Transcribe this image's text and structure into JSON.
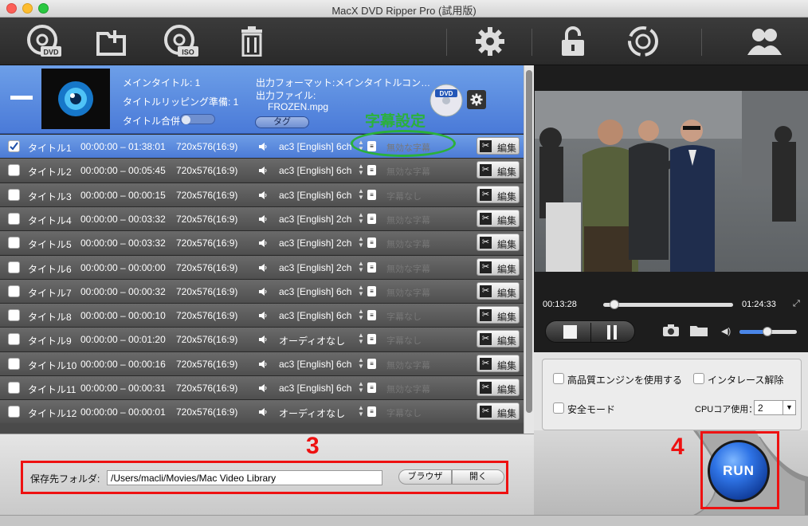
{
  "window": {
    "title": "MacX DVD Ripper Pro (試用版)"
  },
  "toolbar": {
    "icons": [
      "dvd-icon",
      "add-folder-icon",
      "iso-icon",
      "trash-icon",
      "settings-gear-icon",
      "unlock-icon",
      "update-refresh-icon",
      "users-icon"
    ],
    "dvd_label": "DVD",
    "iso_label": "ISO"
  },
  "dvd_info": {
    "main_title": "メインタイトル: 1",
    "ripping_prep": "タイトルリッピング準備: 1",
    "title_merge": "タイトル合併",
    "output_format": "出力フォーマット:メインタイトルコン…",
    "output_file_label": "出力ファイル:",
    "output_file": "FROZEN.mpg",
    "tag_button": "タグ",
    "dvd_badge": "DVD"
  },
  "annotation_subtitle": "字幕設定",
  "titles": [
    {
      "name": "タイトル1",
      "time": "00:00:00 – 01:38:01",
      "res": "720x576(16:9)",
      "audio": "ac3 [English] 6ch",
      "subtitle": "無効な字幕",
      "checked": true,
      "selected": true
    },
    {
      "name": "タイトル2",
      "time": "00:00:00 – 00:05:45",
      "res": "720x576(16:9)",
      "audio": "ac3 [English] 6ch",
      "subtitle": "無効な字幕",
      "checked": false,
      "selected": false
    },
    {
      "name": "タイトル3",
      "time": "00:00:00 – 00:00:15",
      "res": "720x576(16:9)",
      "audio": "ac3 [English] 6ch",
      "subtitle": "字幕なし",
      "checked": false,
      "selected": false
    },
    {
      "name": "タイトル4",
      "time": "00:00:00 – 00:03:32",
      "res": "720x576(16:9)",
      "audio": "ac3 [English] 2ch",
      "subtitle": "無効な字幕",
      "checked": false,
      "selected": false
    },
    {
      "name": "タイトル5",
      "time": "00:00:00 – 00:03:32",
      "res": "720x576(16:9)",
      "audio": "ac3 [English] 2ch",
      "subtitle": "無効な字幕",
      "checked": false,
      "selected": false
    },
    {
      "name": "タイトル6",
      "time": "00:00:00 – 00:00:00",
      "res": "720x576(16:9)",
      "audio": "ac3 [English] 2ch",
      "subtitle": "無効な字幕",
      "checked": false,
      "selected": false
    },
    {
      "name": "タイトル7",
      "time": "00:00:00 – 00:00:32",
      "res": "720x576(16:9)",
      "audio": "ac3 [English] 6ch",
      "subtitle": "無効な字幕",
      "checked": false,
      "selected": false
    },
    {
      "name": "タイトル8",
      "time": "00:00:00 – 00:00:10",
      "res": "720x576(16:9)",
      "audio": "ac3 [English] 6ch",
      "subtitle": "字幕なし",
      "checked": false,
      "selected": false
    },
    {
      "name": "タイトル9",
      "time": "00:00:00 – 00:01:20",
      "res": "720x576(16:9)",
      "audio": "オーディオなし",
      "subtitle": "字幕なし",
      "checked": false,
      "selected": false
    },
    {
      "name": "タイトル10",
      "time": "00:00:00 – 00:00:16",
      "res": "720x576(16:9)",
      "audio": "ac3 [English] 6ch",
      "subtitle": "無効な字幕",
      "checked": false,
      "selected": false
    },
    {
      "name": "タイトル11",
      "time": "00:00:00 – 00:00:31",
      "res": "720x576(16:9)",
      "audio": "ac3 [English] 6ch",
      "subtitle": "無効な字幕",
      "checked": false,
      "selected": false
    },
    {
      "name": "タイトル12",
      "time": "00:00:00 – 00:00:01",
      "res": "720x576(16:9)",
      "audio": "オーディオなし",
      "subtitle": "字幕なし",
      "checked": false,
      "selected": false
    }
  ],
  "edit_label": "編集",
  "output": {
    "folder_label": "保存先フォルダ:",
    "folder_path": "/Users/macli/Movies/Mac Video Library",
    "browse_button": "ブラウザ",
    "open_button": "開く"
  },
  "player": {
    "time_current": "00:13:28",
    "time_total": "01:24:33",
    "progress": 0.05,
    "volume": 0.48
  },
  "options": {
    "high_quality": "高品質エンジンを使用する",
    "deinterlace": "インタレース解除",
    "safe_mode": "安全モード",
    "cpu_label": "CPUコア使用：",
    "cpu_value": "2"
  },
  "run_button": "RUN",
  "step_labels": {
    "three": "3",
    "four": "4"
  },
  "colors": {
    "selected_row": "#5a8be0",
    "annotation_red": "#e11111",
    "annotation_green": "#2bb13b",
    "run_blue": "#1f5fd6"
  }
}
